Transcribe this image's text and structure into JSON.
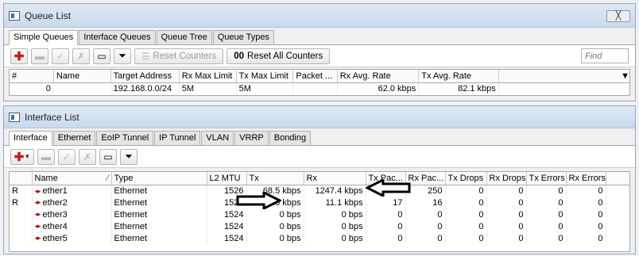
{
  "queue_window": {
    "title": "Queue List",
    "close_label": "╳",
    "tabs": [
      "Simple Queues",
      "Interface Queues",
      "Queue Tree",
      "Queue Types"
    ],
    "toolbar": {
      "reset_counters": "Reset Counters",
      "reset_all_counters": "Reset All Counters",
      "reset_all_icon": "00",
      "find_placeholder": "Find"
    },
    "columns": [
      "#",
      "Name",
      "Target Address",
      "Rx Max Limit",
      "Tx Max Limit",
      "Packet ...",
      "Rx Avg. Rate",
      "Tx Avg. Rate"
    ],
    "rows": [
      {
        "num": "0",
        "name": "",
        "target": "192.168.0.0/24",
        "rx_max": "5M",
        "tx_max": "5M",
        "packet": "",
        "rx_avg": "62.0 kbps",
        "tx_avg": "82.1 kbps"
      }
    ]
  },
  "interface_window": {
    "title": "Interface List",
    "tabs": [
      "Interface",
      "Ethernet",
      "EoIP Tunnel",
      "IP Tunnel",
      "VLAN",
      "VRRP",
      "Bonding"
    ],
    "columns": [
      "",
      "Name",
      "Type",
      "L2 MTU",
      "Tx",
      "Rx",
      "Tx Pac...",
      "Rx Pac...",
      "Tx Drops",
      "Rx Drops",
      "Tx Errors",
      "Rx Errors"
    ],
    "rows": [
      {
        "flag": "R",
        "name": "ether1",
        "type": "Ethernet",
        "mtu": "1526",
        "tx": "68.5 kbps",
        "rx": "1247.4 kbps",
        "tx_pac": "",
        "rx_pac": "250",
        "tx_drops": "0",
        "rx_drops": "0",
        "tx_errors": "0",
        "rx_errors": "0"
      },
      {
        "flag": "R",
        "name": "ether2",
        "type": "Ethernet",
        "mtu": "1524",
        "tx": "20.6 kbps",
        "rx": "11.1 kbps",
        "tx_pac": "17",
        "rx_pac": "16",
        "tx_drops": "0",
        "rx_drops": "0",
        "tx_errors": "0",
        "rx_errors": "0"
      },
      {
        "flag": "",
        "name": "ether3",
        "type": "Ethernet",
        "mtu": "1524",
        "tx": "0 bps",
        "rx": "0 bps",
        "tx_pac": "0",
        "rx_pac": "0",
        "tx_drops": "0",
        "rx_drops": "0",
        "tx_errors": "0",
        "rx_errors": "0"
      },
      {
        "flag": "",
        "name": "ether4",
        "type": "Ethernet",
        "mtu": "1524",
        "tx": "0 bps",
        "rx": "0 bps",
        "tx_pac": "0",
        "rx_pac": "0",
        "tx_drops": "0",
        "rx_drops": "0",
        "tx_errors": "0",
        "rx_errors": "0"
      },
      {
        "flag": "",
        "name": "ether5",
        "type": "Ethernet",
        "mtu": "1524",
        "tx": "0 bps",
        "rx": "0 bps",
        "tx_pac": "0",
        "rx_pac": "0",
        "tx_drops": "0",
        "rx_drops": "0",
        "tx_errors": "0",
        "rx_errors": "0"
      }
    ]
  },
  "icons": [
    "add-icon",
    "remove-icon",
    "enable-icon",
    "disable-icon",
    "comment-icon",
    "filter-icon",
    "reset-counters-icon",
    "dropdown-icon",
    "sort-icon",
    "ethernet-icon",
    "annotation-arrow-icon"
  ],
  "colors": {
    "accent_red": "#c81c1c",
    "title_bar": "#c9d9ec"
  }
}
